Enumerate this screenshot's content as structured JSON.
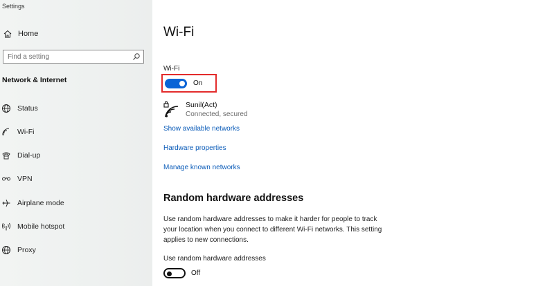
{
  "app": {
    "title": "Settings"
  },
  "sidebar": {
    "home_label": "Home",
    "search_placeholder": "Find a setting",
    "section_title": "Network & Internet",
    "items": [
      {
        "label": "Status",
        "icon": "globe-icon"
      },
      {
        "label": "Wi-Fi",
        "icon": "wifi-icon"
      },
      {
        "label": "Dial-up",
        "icon": "phone-icon"
      },
      {
        "label": "VPN",
        "icon": "vpn-icon"
      },
      {
        "label": "Airplane mode",
        "icon": "airplane-icon"
      },
      {
        "label": "Mobile hotspot",
        "icon": "hotspot-icon"
      },
      {
        "label": "Proxy",
        "icon": "globe-icon"
      }
    ]
  },
  "main": {
    "title": "Wi-Fi",
    "wifi_label": "Wi-Fi",
    "wifi_toggle": {
      "state": "On",
      "on": true
    },
    "network": {
      "name": "Sunil(Act)",
      "status": "Connected, secured"
    },
    "links": {
      "show_networks": "Show available networks",
      "hardware_properties": "Hardware properties",
      "manage_networks": "Manage known networks"
    },
    "random_hw": {
      "title": "Random hardware addresses",
      "description": "Use random hardware addresses to make it harder for people to track your location when you connect to different Wi-Fi networks. This setting applies to new connections.",
      "toggle_label": "Use random hardware addresses",
      "toggle_state": "Off",
      "on": false
    }
  },
  "colors": {
    "accent": "#0a64d6",
    "link": "#0a5bb8",
    "highlight": "#e32b2b"
  }
}
